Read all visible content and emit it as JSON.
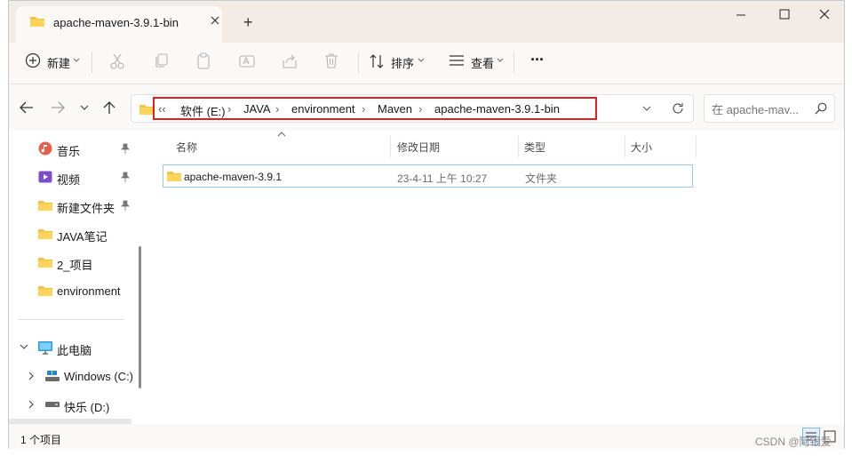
{
  "window": {
    "tab_title": "apache-maven-3.9.1-bin",
    "new_tab_symbol": "+"
  },
  "toolbar": {
    "new_label": "新建",
    "sort_label": "排序",
    "view_label": "查看",
    "more_symbol": "···"
  },
  "address": {
    "overflow": "‹‹",
    "crumbs": [
      "软件 (E:)",
      "JAVA",
      "environment",
      "Maven",
      "apache-maven-3.9.1-bin"
    ],
    "highlight_color": "#e02020"
  },
  "search": {
    "placeholder": "在 apache-mav..."
  },
  "sidebar": {
    "items": [
      {
        "label": "音乐",
        "icon": "music-icon",
        "pinned": true
      },
      {
        "label": "视频",
        "icon": "video-icon",
        "pinned": true
      },
      {
        "label": "新建文件夹",
        "icon": "folder-icon",
        "pinned": true
      },
      {
        "label": "JAVA笔记",
        "icon": "folder-icon",
        "pinned": false
      },
      {
        "label": "2_项目",
        "icon": "folder-icon",
        "pinned": false
      },
      {
        "label": "environment",
        "icon": "folder-icon",
        "pinned": false
      }
    ],
    "this_pc": "此电脑",
    "drives": [
      {
        "label": "Windows (C:)",
        "icon": "drive-icon"
      },
      {
        "label": "快乐 (D:)",
        "icon": "drive-icon"
      }
    ]
  },
  "table": {
    "headers": {
      "name": "名称",
      "date": "修改日期",
      "type": "类型",
      "size": "大小"
    },
    "rows": [
      {
        "name": "apache-maven-3.9.1",
        "date": "23-4-11 上午 10:27",
        "type": "文件夹",
        "size": ""
      }
    ]
  },
  "status": {
    "count": "1 个项目"
  },
  "watermark": "CSDN @阿银爱",
  "colors": {
    "folder": "#f5c342",
    "accent": "#0067c0",
    "selection_border": "#99c9ef"
  }
}
